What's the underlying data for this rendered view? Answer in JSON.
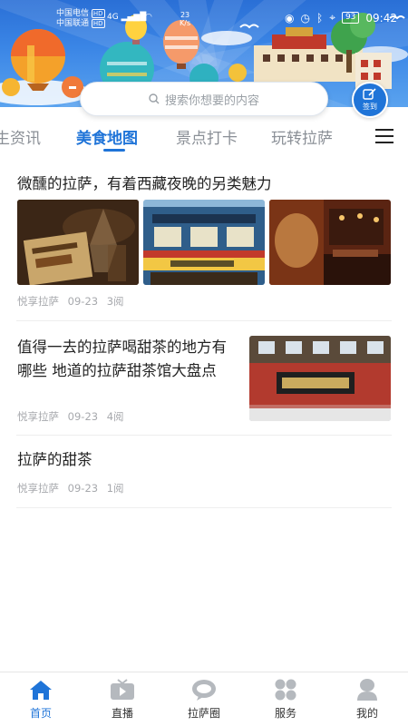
{
  "status_bar": {
    "carrier1": "中国电信",
    "carrier2": "中国联通",
    "hd": "HD",
    "net": "4G",
    "speed_value": "23",
    "speed_unit": "K/s",
    "battery": "93",
    "time": "09:42"
  },
  "header": {
    "search_placeholder": "搜索你想要的内容",
    "checkin_label": "签到"
  },
  "tabs": [
    {
      "label": "生资讯",
      "active": false
    },
    {
      "label": "美食地图",
      "active": true
    },
    {
      "label": "景点打卡",
      "active": false
    },
    {
      "label": "玩转拉萨",
      "active": false
    }
  ],
  "articles": [
    {
      "title": "微醺的拉萨，有着西藏夜晚的另类魅力",
      "source": "悦享拉萨",
      "date": "09-23",
      "reads": "3阅"
    },
    {
      "title": "值得一去的拉萨喝甜茶的地方有哪些 地道的拉萨甜茶馆大盘点",
      "source": "悦享拉萨",
      "date": "09-23",
      "reads": "4阅"
    },
    {
      "title": "拉萨的甜茶",
      "source": "悦享拉萨",
      "date": "09-23",
      "reads": "1阅"
    }
  ],
  "bottom_nav": [
    {
      "label": "首页",
      "icon": "home-icon",
      "active": true
    },
    {
      "label": "直播",
      "icon": "tv-icon",
      "active": false
    },
    {
      "label": "拉萨圈",
      "icon": "chat-bubble-icon",
      "active": false
    },
    {
      "label": "服务",
      "icon": "grid-icon",
      "active": false
    },
    {
      "label": "我的",
      "icon": "user-icon",
      "active": false
    }
  ],
  "colors": {
    "accent": "#1f74d8",
    "banner": "#2a6fd6",
    "text_muted": "#a7a9ad"
  }
}
